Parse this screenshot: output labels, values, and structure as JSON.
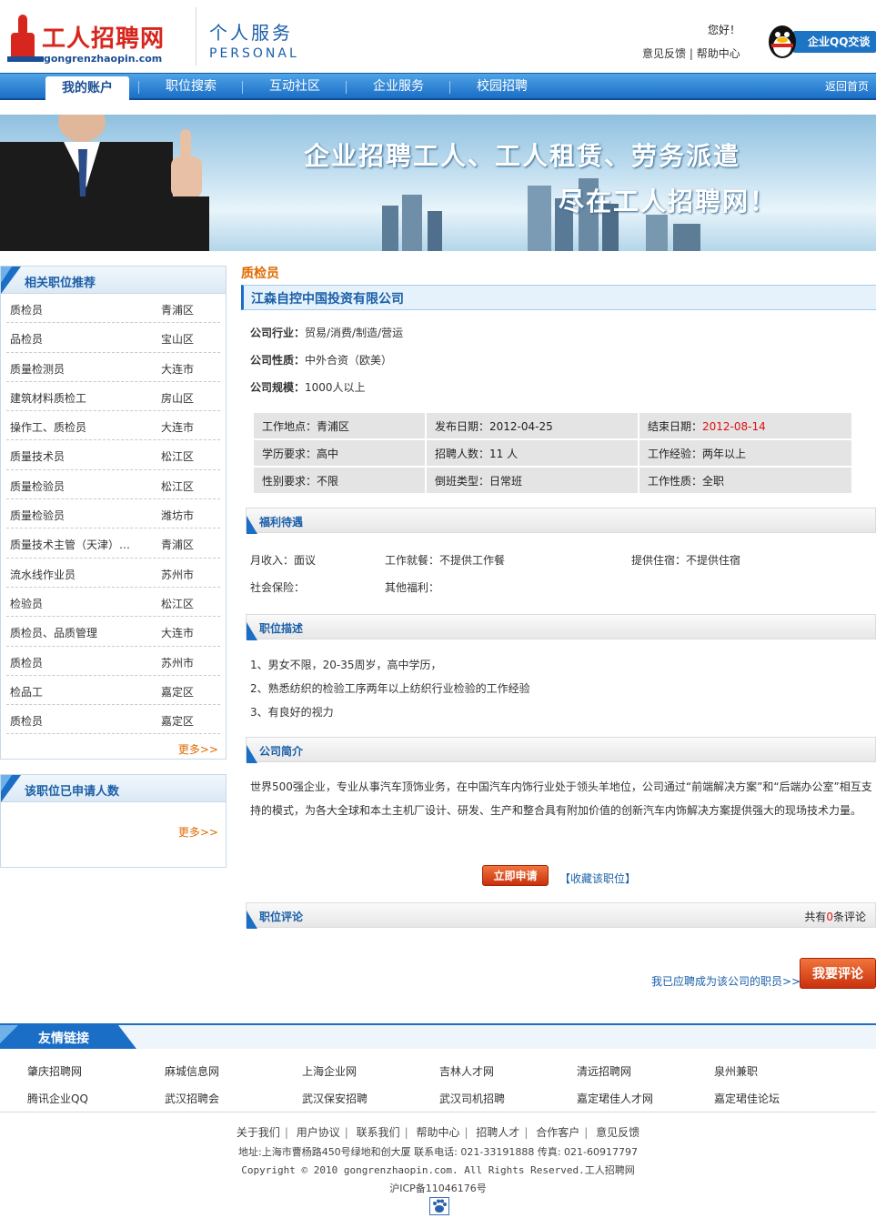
{
  "header": {
    "logo_title": "工人招聘网",
    "logo_url": "gongrenzhaopin.com",
    "personal_cn": "个人服务",
    "personal_en": "PERSONAL",
    "hello": "您好！",
    "feedback": "意见反馈",
    "help": "帮助中心",
    "qq_label": "企业QQ交谈"
  },
  "nav": {
    "items": [
      "我的账户",
      "职位搜索",
      "互动社区",
      "企业服务",
      "校园招聘"
    ],
    "home": "返回首页"
  },
  "banner": {
    "line1": "企业招聘工人、工人租赁、劳务派遣",
    "line2": "尽在工人招聘网！"
  },
  "sidebar": {
    "rec_title": "相关职位推荐",
    "rec_items": [
      {
        "name": "质检员",
        "city": "青浦区"
      },
      {
        "name": "品检员",
        "city": "宝山区"
      },
      {
        "name": "质量检测员",
        "city": "大连市"
      },
      {
        "name": "建筑材料质检工",
        "city": "房山区"
      },
      {
        "name": "操作工、质检员",
        "city": "大连市"
      },
      {
        "name": "质量技术员",
        "city": "松江区"
      },
      {
        "name": "质量检验员",
        "city": "松江区"
      },
      {
        "name": "质量检验员",
        "city": "潍坊市"
      },
      {
        "name": "质量技术主管（天津）…",
        "city": "青浦区"
      },
      {
        "name": "流水线作业员",
        "city": "苏州市"
      },
      {
        "name": "检验员",
        "city": "松江区"
      },
      {
        "name": "质检员、品质管理",
        "city": "大连市"
      },
      {
        "name": "质检员",
        "city": "苏州市"
      },
      {
        "name": "检品工",
        "city": "嘉定区"
      },
      {
        "name": "质检员",
        "city": "嘉定区"
      }
    ],
    "more": "更多>>",
    "applied_title": "该职位已申请人数",
    "applied_more": "更多>>"
  },
  "job": {
    "title": "质检员",
    "company": "江森自控中国投资有限公司",
    "industry_label": "公司行业：",
    "industry": "贸易/消费/制造/营运",
    "nature_label": "公司性质：",
    "nature": "中外合资（欧美）",
    "scale_label": "公司规模：",
    "scale": "1000人以上",
    "location_label": "工作地点：",
    "location": "青浦区",
    "publish_label": "发布日期：",
    "publish": "2012-04-25",
    "end_label": "结束日期：",
    "end": "2012-08-14",
    "edu_label": "学历要求：",
    "edu": "高中",
    "count_label": "招聘人数：",
    "count": "11 人",
    "exp_label": "工作经验：",
    "exp": "两年以上",
    "gender_label": "性别要求：",
    "gender": "不限",
    "shift_label": "倒班类型：",
    "shift": "日常班",
    "jobtype_label": "工作性质：",
    "jobtype": "全职"
  },
  "welfare": {
    "title": "福利待遇",
    "income": "月收入：面议",
    "meal": "工作就餐：不提供工作餐",
    "housing": "提供住宿：不提供住宿",
    "insurance": "社会保险：",
    "other": "其他福利："
  },
  "description": {
    "title": "职位描述",
    "lines": [
      "1、男女不限，20-35周岁，高中学历，",
      "2、熟悉纺织的检验工序两年以上纺织行业检验的工作经验",
      "3、有良好的视力"
    ]
  },
  "company_intro": {
    "title": "公司简介",
    "text": "世界500强企业，专业从事汽车顶饰业务，在中国汽车内饰行业处于领头羊地位，公司通过“前端解决方案”和“后端办公室”相互支持的模式，为各大全球和本土主机厂设计、研发、生产和整合具有附加价值的创新汽车内饰解决方案提供强大的现场技术力量。"
  },
  "actions": {
    "apply": "立即申请",
    "favorite": "【收藏该职位】"
  },
  "comments": {
    "title": "职位评论",
    "count_prefix": "共有",
    "count": "0",
    "count_suffix": "条评论",
    "applied_link": "我已应聘成为该公司的职员>>",
    "comment_button": "我要评论"
  },
  "friend_links": {
    "title": "友情链接",
    "row1": [
      "肇庆招聘网",
      "麻城信息网",
      "上海企业网",
      "吉林人才网",
      "清远招聘网",
      "泉州兼职"
    ],
    "row2": [
      "腾讯企业QQ",
      "武汉招聘会",
      "武汉保安招聘",
      "武汉司机招聘",
      "嘉定珺佳人才网",
      "嘉定珺佳论坛"
    ]
  },
  "footer": {
    "links": [
      "关于我们",
      "用户协议",
      "联系我们",
      "帮助中心",
      "招聘人才",
      "合作客户",
      "意见反馈"
    ],
    "address": "地址:上海市曹杨路450号绿地和创大厦  联系电话: 021-33191888 传真: 021-60917797",
    "copyright": "Copyright © 2010 gongrenzhaopin.com. All Rights Reserved.工人招聘网",
    "icp": "沪ICP备11046176号"
  },
  "colors": {
    "brand_blue": "#1a6ec6",
    "brand_red": "#d7261e",
    "accent_orange": "#e06a00"
  }
}
